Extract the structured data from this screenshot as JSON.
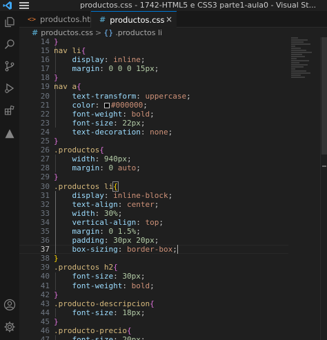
{
  "window": {
    "title": "productos.css - 1742-HTML5 e CSS3 parte1-aula0 - Visual St..."
  },
  "icons": {
    "logo": "vscode-logo-icon",
    "menu": "hamburger-menu-icon",
    "activity": [
      "explorer-icon",
      "search-icon",
      "source-control-icon",
      "run-debug-icon",
      "extensions-icon",
      "remote-icon",
      "accounts-icon",
      "settings-gear-icon"
    ]
  },
  "tabs": [
    {
      "label": "productos.html",
      "icon": "<>"
    },
    {
      "label": "productos.css",
      "icon": "#",
      "close": "×"
    }
  ],
  "breadcrumb": {
    "file_icon": "#",
    "file": "productos.css",
    "separator": ">",
    "symbol_icon": "{}",
    "symbol": ".productos li"
  },
  "editor": {
    "active_line": 37,
    "line_numbers": [
      "14",
      "15",
      "16",
      "17",
      "18",
      "19",
      "20",
      "21",
      "22",
      "23",
      "24",
      "25",
      "26",
      "27",
      "28",
      "29",
      "30",
      "31",
      "32",
      "33",
      "34",
      "35",
      "36",
      "37",
      "38",
      "39",
      "40",
      "41",
      "42",
      "43",
      "44",
      "45",
      "46",
      "47"
    ]
  },
  "colors": {
    "accent": "#0078d4",
    "selector": "#d7ba7d",
    "property": "#9cdcfe",
    "value": "#ce9178",
    "number": "#b5cea8",
    "bracket": "#da70d6"
  }
}
